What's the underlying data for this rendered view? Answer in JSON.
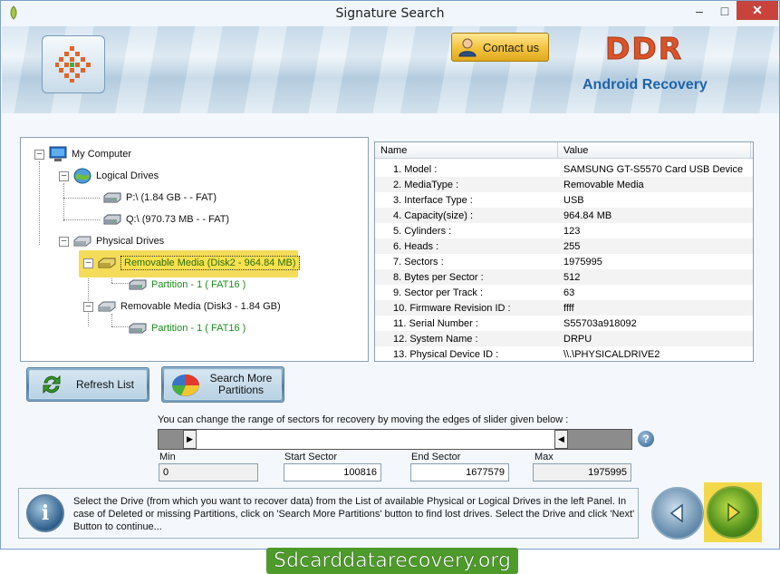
{
  "window": {
    "title": "Signature Search"
  },
  "banner": {
    "contact_label": "Contact us",
    "brand": "DDR",
    "product": "Android Recovery"
  },
  "tree": {
    "root": "My Computer",
    "logical": "Logical Drives",
    "drive_p": "P:\\ (1.84 GB -  - FAT)",
    "drive_q": "Q:\\ (970.73 MB -  - FAT)",
    "physical": "Physical Drives",
    "disk2": "Removable Media (Disk2 - 964.84 MB)",
    "disk2_part": "Partition - 1 ( FAT16 )",
    "disk3": "Removable Media (Disk3 - 1.84 GB)",
    "disk3_part": "Partition - 1 ( FAT16 )"
  },
  "properties": {
    "col_name": "Name",
    "col_value": "Value",
    "rows": [
      {
        "name": "1. Model :",
        "value": "SAMSUNG GT-S5570 Card USB Device"
      },
      {
        "name": "2. MediaType :",
        "value": "Removable Media"
      },
      {
        "name": "3. Interface Type :",
        "value": "USB"
      },
      {
        "name": "4. Capacity(size) :",
        "value": "964.84 MB"
      },
      {
        "name": "5. Cylinders :",
        "value": "123"
      },
      {
        "name": "6. Heads :",
        "value": "255"
      },
      {
        "name": "7. Sectors :",
        "value": "1975995"
      },
      {
        "name": "8. Bytes per Sector :",
        "value": "512"
      },
      {
        "name": "9. Sector per Track :",
        "value": "63"
      },
      {
        "name": "10. Firmware Revision ID :",
        "value": "ffff"
      },
      {
        "name": "11. Serial Number :",
        "value": "S55703a918092"
      },
      {
        "name": "12. System Name :",
        "value": "DRPU"
      },
      {
        "name": "13. Physical Device ID :",
        "value": "\\\\.\\PHYSICALDRIVE2"
      }
    ]
  },
  "buttons": {
    "refresh": "Refresh List",
    "search_more_1": "Search More",
    "search_more_2": "Partitions"
  },
  "slider": {
    "caption": "You can change the range of sectors for recovery by moving the edges of slider given below :",
    "min_label": "Min",
    "min_value": "0",
    "start_label": "Start Sector",
    "start_value": "100816",
    "end_label": "End Sector",
    "end_value": "1677579",
    "max_label": "Max",
    "max_value": "1975995",
    "help": "?"
  },
  "info": {
    "text": "Select the Drive (from which you want to recover data) from the List of available Physical or Logical Drives in the left Panel. In case of Deleted or missing Partitions, click on 'Search More Partitions' button to find lost drives. Select the Drive and click 'Next' Button to continue...",
    "icon": "i"
  },
  "footer": {
    "text": "Sdcarddatarecovery.org"
  }
}
